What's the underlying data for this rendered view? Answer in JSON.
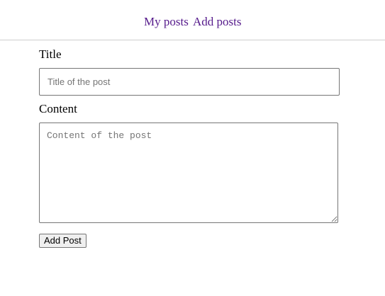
{
  "nav": {
    "my_posts": "My posts",
    "add_posts": "Add posts"
  },
  "form": {
    "title_label": "Title",
    "title_placeholder": "Title of the post",
    "title_value": "",
    "content_label": "Content",
    "content_placeholder": "Content of the post",
    "content_value": "",
    "submit_label": "Add Post"
  },
  "colors": {
    "link": "#551a8b",
    "divider": "#cfcfcf",
    "input_border": "#767676",
    "button_bg": "#efefef"
  }
}
